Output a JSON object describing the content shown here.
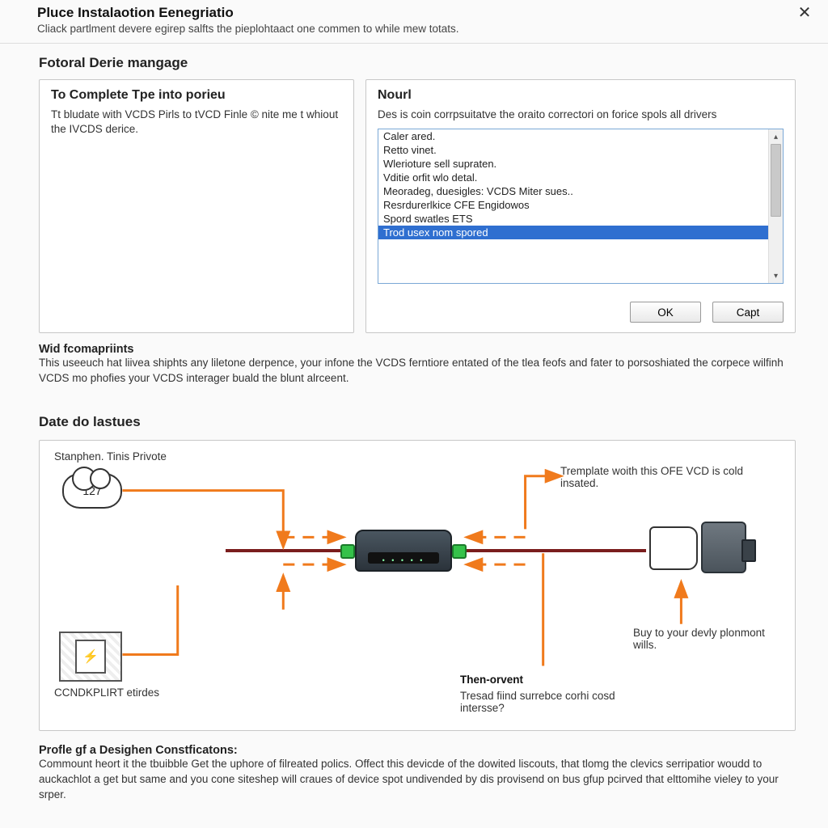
{
  "titlebar": {
    "title": "Pluce Instalaotion Eenegriatio",
    "subtitle": "Cliack partlment devere egirep salfts the pieplohtaact one commen to while mew totats."
  },
  "section1": {
    "heading": "Fotoral Derie mangage",
    "left": {
      "title": "To Complete Tpe into porieu",
      "body": "Tt bludate with VCDS Pirls to tVCD Finle © nite me t whiout the IVCDS derice."
    },
    "right": {
      "title": "Nourl",
      "body": "Des is coin corrpsuitatve the oraito correctori on forice spols all drivers",
      "items": [
        "Caler ared.",
        "Retto vinet.",
        "Wlerioture sell supraten.",
        "Vditie orfit wlo detal.",
        "Meoradeg, duesigles: VCDS Miter sues..",
        "Resrdurerlkice CFE Engidowos",
        "Spord swatles ETS",
        "Trod usex nom spored"
      ],
      "selected_index": 7,
      "ok_label": "OK",
      "cancel_label": "Capt"
    }
  },
  "midpara": {
    "title": "Wid fcomapriints",
    "body": "This useeuch hat liivea shiphts any liletone derpence, your infone the VCDS ferntiore entated of the tlea feofs and fater to porsoshiated the corpece wilfinh VCDS mo phofies your VCDS interager buald the blunt alrceent."
  },
  "diagram": {
    "title": "Date do lastues",
    "top_left_label": "Stanphen. Tinis Privote",
    "cloud_value": "127",
    "ctrl_label": "CCNDKPLIRT etirdes",
    "right_top_note": "Tremplate woith this OFE VCD is cold insated.",
    "right_bottom_note": "Buy to your devly plonmont wills.",
    "center_bottom_title": "Then-orvent",
    "center_bottom_body": "Tresad fiind surrebce corhi cosd intersse?"
  },
  "footer": {
    "title": "Profle gf a Desighen Constficatons:",
    "body": "Commount heort it the tbuibble Get the uphore of filreated polics. Offect this devicde of the dowited liscouts, that tlomg the clevics serripatior woudd to auckachlot a get but same and you cone siteshep will craues of device spot undivended by dis provisend on bus gfup pcirved that elttomihe vieley to your srper."
  }
}
